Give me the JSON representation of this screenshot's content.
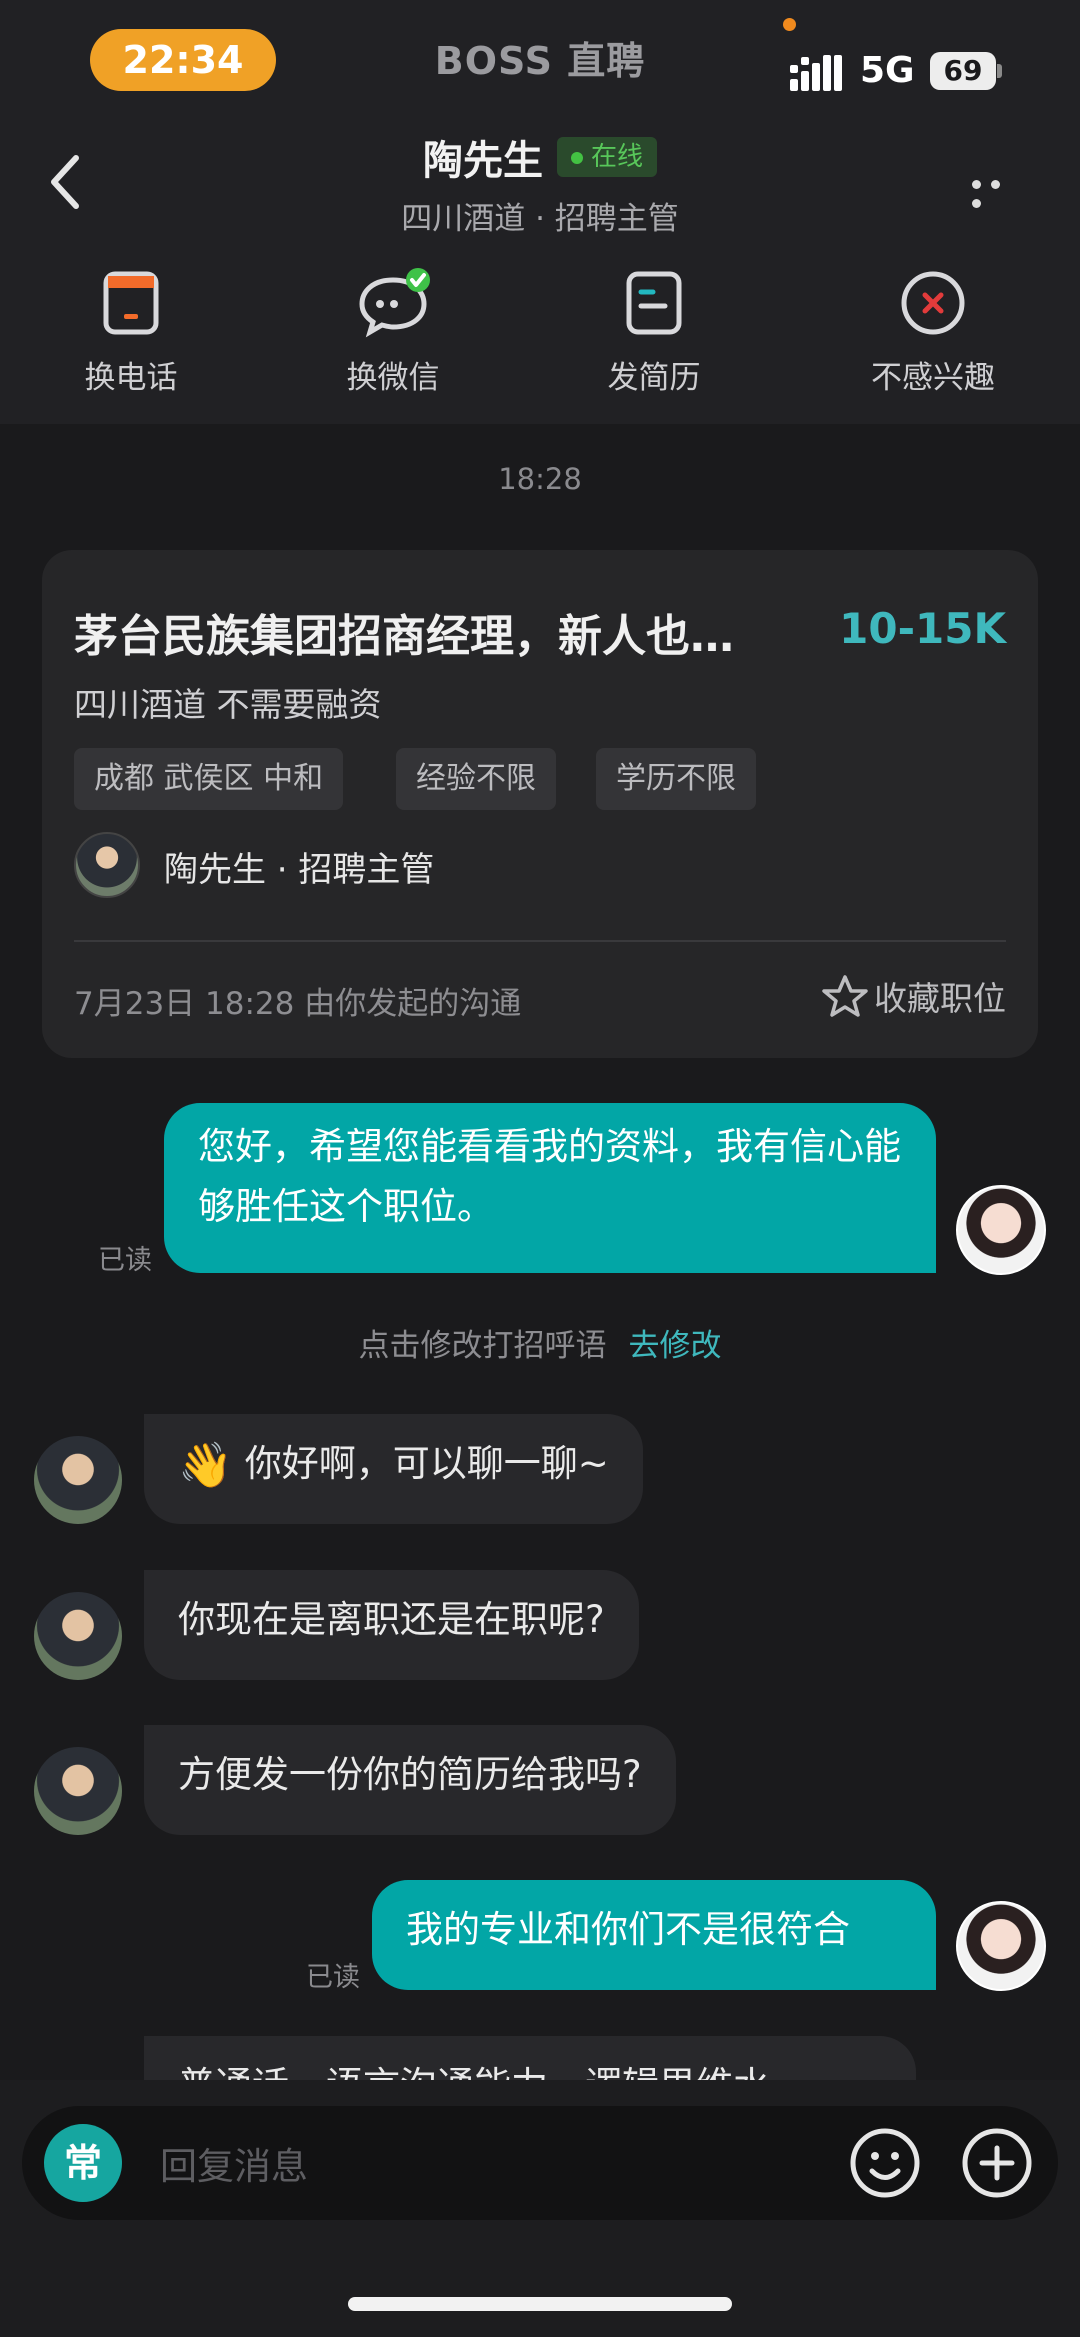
{
  "status_bar": {
    "time": "22:34",
    "app_name": "BOSS 直聘",
    "network": "5G",
    "battery": "69"
  },
  "header": {
    "name": "陶先生",
    "online": "在线",
    "subtitle": "四川酒道 · 招聘主管",
    "actions": [
      {
        "label": "换电话",
        "icon": "phone-card-icon"
      },
      {
        "label": "换微信",
        "icon": "wechat-icon"
      },
      {
        "label": "发简历",
        "icon": "resume-icon"
      },
      {
        "label": "不感兴趣",
        "icon": "close-circle-icon"
      }
    ]
  },
  "chat": {
    "timestamp": "18:28",
    "job_card": {
      "title": "茅台民族集团招商经理，新人也…",
      "salary": "10-15K",
      "company": "四川酒道 不需要融资",
      "tags": [
        "成都 武侯区 中和",
        "经验不限",
        "学历不限"
      ],
      "recruiter": "陶先生 · 招聘主管",
      "footer": "7月23日 18:28 由你发起的沟通",
      "favorite": "收藏职位"
    },
    "messages": {
      "out_1": "您好，希望您能看看我的资料，我有信心能够胜任这个职位。",
      "read_1": "已读",
      "hint": "点击修改打招呼语",
      "hint_link": "去修改",
      "in_1": "你好啊，可以聊一聊~",
      "in_1_emoji": "👋",
      "in_2": "你现在是离职还是在职呢?",
      "in_3": "方便发一份你的简历给我吗?",
      "out_2": "我的专业和你们不是很符合",
      "read_2": "已读",
      "in_4_partial": "普通话、语言沟通能力、逻辑思维水"
    }
  },
  "input": {
    "quick_label": "常",
    "placeholder": "回复消息"
  },
  "colors": {
    "accent": "#02a6a6",
    "online": "#43c243",
    "time_pill": "#f0a126"
  }
}
